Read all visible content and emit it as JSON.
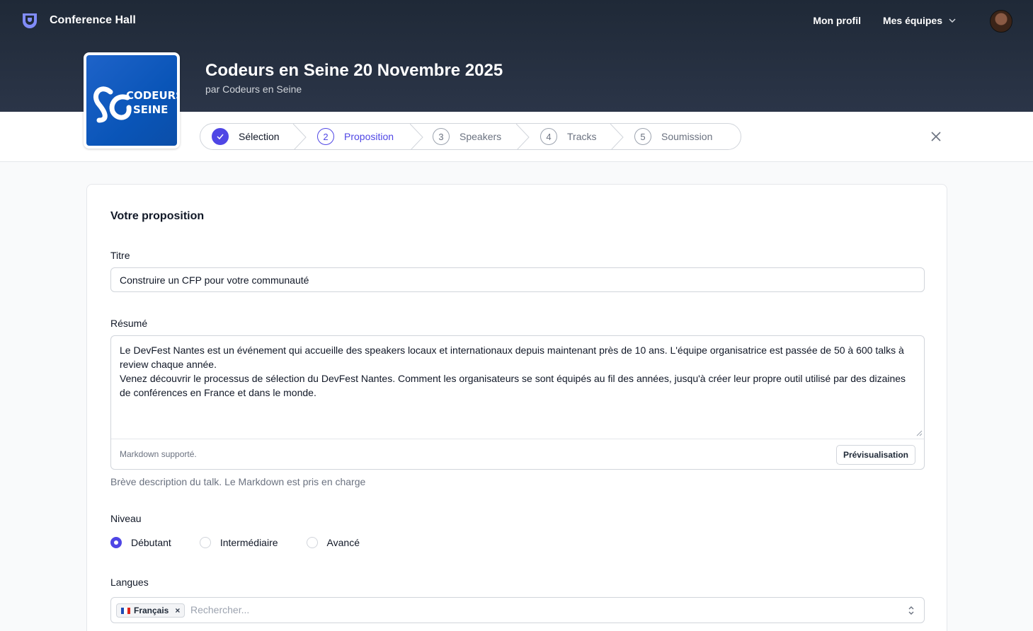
{
  "app": {
    "name": "Conference Hall"
  },
  "topnav": {
    "profile": "Mon profil",
    "teams": "Mes équipes"
  },
  "event": {
    "title": "Codeurs en Seine 20 Novembre 2025",
    "subtitle": "par Codeurs en Seine",
    "logo_line1": "CODEURS",
    "logo_line2": "SEINE"
  },
  "steps": [
    {
      "number": "1",
      "label": "Sélection",
      "state": "done"
    },
    {
      "number": "2",
      "label": "Proposition",
      "state": "current"
    },
    {
      "number": "3",
      "label": "Speakers",
      "state": "todo"
    },
    {
      "number": "4",
      "label": "Tracks",
      "state": "todo"
    },
    {
      "number": "5",
      "label": "Soumission",
      "state": "todo"
    }
  ],
  "form": {
    "section_title": "Votre proposition",
    "title_label": "Titre",
    "title_value": "Construire un CFP pour votre communauté",
    "abstract_label": "Résumé",
    "abstract_line1": "Le DevFest Nantes est un événement qui accueille des speakers locaux et internationaux depuis maintenant près de 10 ans. L'équipe organisatrice est passée de 50 à 600 talks à review chaque année.",
    "abstract_line2": "Venez découvrir le processus de sélection du DevFest Nantes. Comment les organisateurs se sont équipés au fil des années, jusqu'à créer leur propre outil utilisé par des dizaines de conférences en France et dans le monde.",
    "markdown_note": "Markdown supporté.",
    "preview_button": "Prévisualisation",
    "abstract_help": "Brève description du talk. Le Markdown est pris en charge",
    "level_label": "Niveau",
    "levels": [
      {
        "label": "Débutant",
        "selected": true
      },
      {
        "label": "Intermédiaire",
        "selected": false
      },
      {
        "label": "Avancé",
        "selected": false
      }
    ],
    "languages_label": "Langues",
    "selected_language": "Français",
    "language_remove": "×",
    "language_placeholder": "Rechercher..."
  },
  "colors": {
    "accent": "#4f46e5",
    "header": "#1f2937"
  }
}
